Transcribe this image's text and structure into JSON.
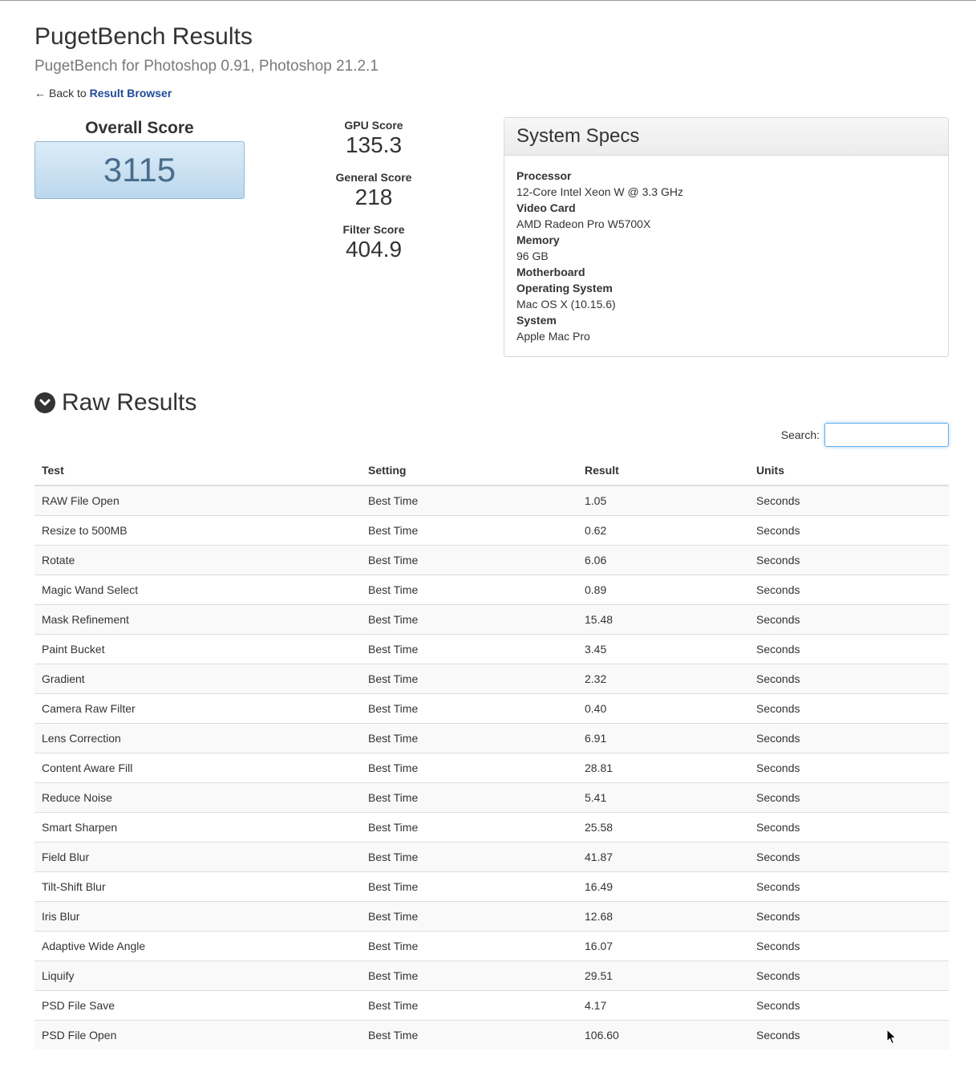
{
  "header": {
    "title": "PugetBench Results",
    "subtitle": "PugetBench for Photoshop 0.91, Photoshop 21.2.1",
    "back_prefix": "Back to",
    "back_link": "Result Browser"
  },
  "overall": {
    "label": "Overall Score",
    "value": "3115"
  },
  "scores": [
    {
      "label": "GPU Score",
      "value": "135.3"
    },
    {
      "label": "General Score",
      "value": "218"
    },
    {
      "label": "Filter Score",
      "value": "404.9"
    }
  ],
  "specs": {
    "title": "System Specs",
    "processor_label": "Processor",
    "processor_value": "12-Core Intel Xeon W @ 3.3 GHz",
    "video_label": "Video Card",
    "video_value": "AMD Radeon Pro W5700X",
    "memory_label": "Memory",
    "memory_value": "96 GB",
    "motherboard_label": "Motherboard",
    "os_label": "Operating System",
    "os_value": "Mac OS X (10.15.6)",
    "system_label": "System",
    "system_value": "Apple Mac Pro"
  },
  "raw": {
    "title": "Raw Results",
    "search_label": "Search:",
    "search_value": "",
    "columns": [
      "Test",
      "Setting",
      "Result",
      "Units"
    ],
    "rows": [
      [
        "RAW File Open",
        "Best Time",
        "1.05",
        "Seconds"
      ],
      [
        "Resize to 500MB",
        "Best Time",
        "0.62",
        "Seconds"
      ],
      [
        "Rotate",
        "Best Time",
        "6.06",
        "Seconds"
      ],
      [
        "Magic Wand Select",
        "Best Time",
        "0.89",
        "Seconds"
      ],
      [
        "Mask Refinement",
        "Best Time",
        "15.48",
        "Seconds"
      ],
      [
        "Paint Bucket",
        "Best Time",
        "3.45",
        "Seconds"
      ],
      [
        "Gradient",
        "Best Time",
        "2.32",
        "Seconds"
      ],
      [
        "Camera Raw Filter",
        "Best Time",
        "0.40",
        "Seconds"
      ],
      [
        "Lens Correction",
        "Best Time",
        "6.91",
        "Seconds"
      ],
      [
        "Content Aware Fill",
        "Best Time",
        "28.81",
        "Seconds"
      ],
      [
        "Reduce Noise",
        "Best Time",
        "5.41",
        "Seconds"
      ],
      [
        "Smart Sharpen",
        "Best Time",
        "25.58",
        "Seconds"
      ],
      [
        "Field Blur",
        "Best Time",
        "41.87",
        "Seconds"
      ],
      [
        "Tilt-Shift Blur",
        "Best Time",
        "16.49",
        "Seconds"
      ],
      [
        "Iris Blur",
        "Best Time",
        "12.68",
        "Seconds"
      ],
      [
        "Adaptive Wide Angle",
        "Best Time",
        "16.07",
        "Seconds"
      ],
      [
        "Liquify",
        "Best Time",
        "29.51",
        "Seconds"
      ],
      [
        "PSD File Save",
        "Best Time",
        "4.17",
        "Seconds"
      ],
      [
        "PSD File Open",
        "Best Time",
        "106.60",
        "Seconds"
      ]
    ]
  },
  "icons": {
    "back_arrow": "left-arrow-icon",
    "collapse": "chevron-down-circle-icon",
    "cursor": "mouse-pointer-icon"
  }
}
